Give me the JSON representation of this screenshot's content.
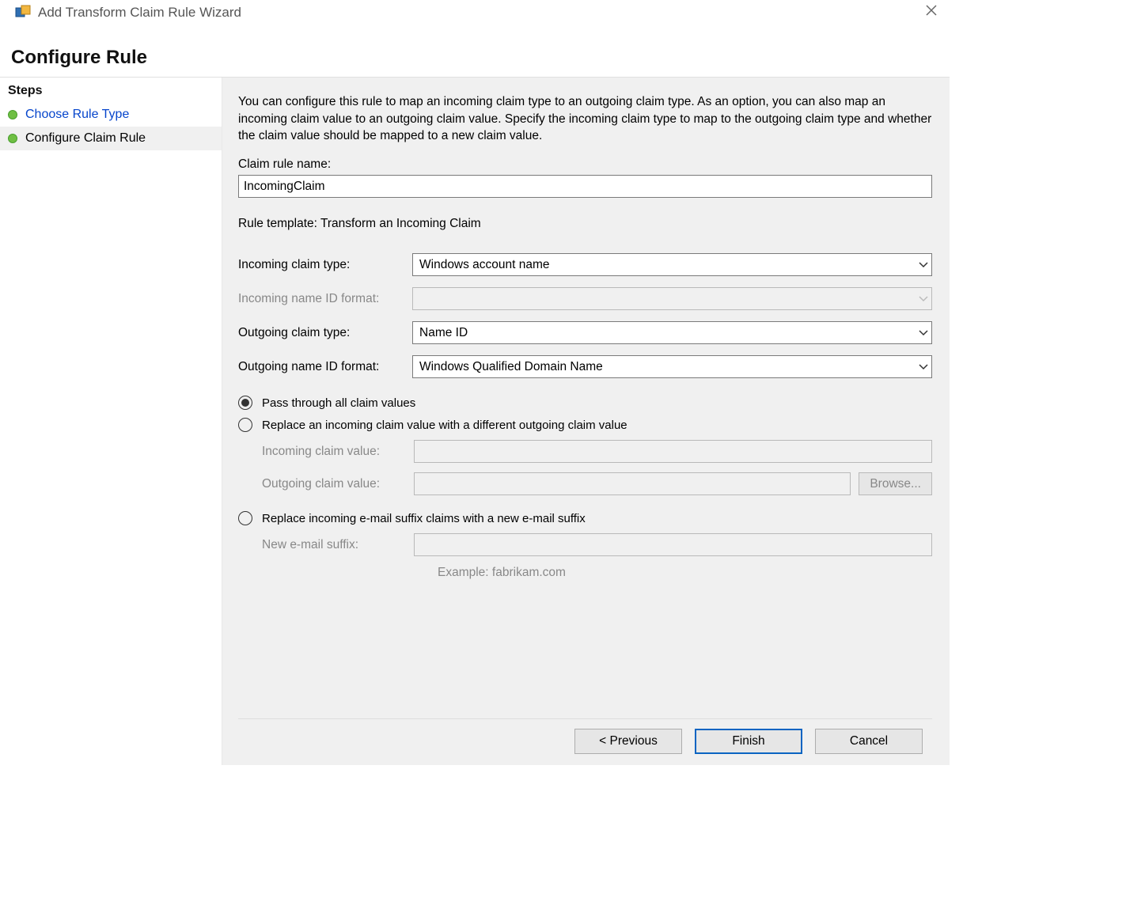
{
  "window": {
    "title": "Add Transform Claim Rule Wizard"
  },
  "page_title": "Configure Rule",
  "sidebar": {
    "heading": "Steps",
    "items": [
      {
        "label": "Choose Rule Type",
        "link": true
      },
      {
        "label": "Configure Claim Rule",
        "current": true
      }
    ]
  },
  "content": {
    "description": "You can configure this rule to map an incoming claim type to an outgoing claim type. As an option, you can also map an incoming claim value to an outgoing claim value. Specify the incoming claim type to map to the outgoing claim type and whether the claim value should be mapped to a new claim value.",
    "claim_rule_name_label": "Claim rule name:",
    "claim_rule_name_value": "IncomingClaim",
    "rule_template_label": "Rule template: Transform an Incoming Claim",
    "rows": {
      "incoming_type_label": "Incoming claim type:",
      "incoming_type_value": "Windows account name",
      "incoming_nameid_label": "Incoming name ID format:",
      "incoming_nameid_value": "",
      "outgoing_type_label": "Outgoing claim type:",
      "outgoing_type_value": "Name ID",
      "outgoing_nameid_label": "Outgoing name ID format:",
      "outgoing_nameid_value": "Windows Qualified Domain Name"
    },
    "radios": {
      "opt1": "Pass through all claim values",
      "opt2": "Replace an incoming claim value with a different outgoing claim value",
      "opt2_incoming_label": "Incoming claim value:",
      "opt2_outgoing_label": "Outgoing claim value:",
      "browse_label": "Browse...",
      "opt3": "Replace incoming e-mail suffix claims with a new e-mail suffix",
      "opt3_suffix_label": "New e-mail suffix:",
      "opt3_example": "Example: fabrikam.com"
    }
  },
  "buttons": {
    "previous": "< Previous",
    "finish": "Finish",
    "cancel": "Cancel"
  }
}
